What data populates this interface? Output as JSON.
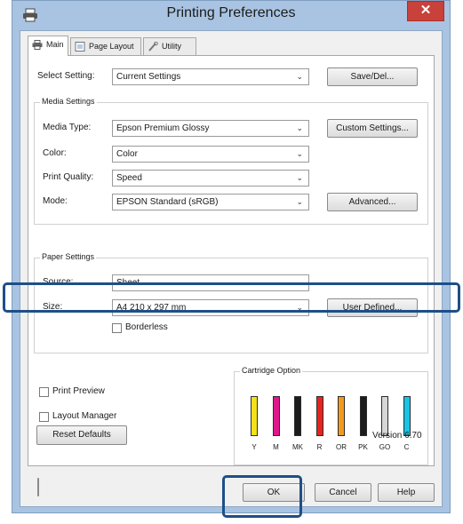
{
  "window": {
    "title": "Printing Preferences",
    "close_label": "✕"
  },
  "tabs": [
    {
      "label": "Main"
    },
    {
      "label": "Page Layout"
    },
    {
      "label": "Utility"
    }
  ],
  "select_setting": {
    "label": "Select Setting:",
    "value": "Current Settings",
    "button": "Save/Del..."
  },
  "media_settings": {
    "group_label": "Media Settings",
    "media_type": {
      "label": "Media Type:",
      "value": "Epson Premium Glossy",
      "button": "Custom Settings..."
    },
    "color": {
      "label": "Color:",
      "value": "Color"
    },
    "print_quality": {
      "label": "Print Quality:",
      "value": "Speed"
    },
    "mode": {
      "label": "Mode:",
      "value": "EPSON Standard (sRGB)",
      "button": "Advanced..."
    }
  },
  "paper_settings": {
    "group_label": "Paper Settings",
    "source": {
      "label": "Source:",
      "value": "Sheet"
    },
    "size": {
      "label": "Size:",
      "value": "A4 210 x 297 mm",
      "button": "User Defined..."
    },
    "borderless_label": "Borderless"
  },
  "print_preview_label": "Print Preview",
  "layout_manager_label": "Layout Manager",
  "cartridge": {
    "group_label": "Cartridge Option",
    "inks": [
      {
        "code": "Y",
        "color": "#f2e21a"
      },
      {
        "code": "M",
        "color": "#e0168c"
      },
      {
        "code": "MK",
        "color": "#1c1c1c"
      },
      {
        "code": "R",
        "color": "#e52420"
      },
      {
        "code": "OR",
        "color": "#f39a1c"
      },
      {
        "code": "PK",
        "color": "#1c1c1c"
      },
      {
        "code": "GO",
        "color": "#d6d6d6"
      },
      {
        "code": "C",
        "color": "#19c4e6"
      }
    ]
  },
  "reset_defaults_label": "Reset Defaults",
  "version": "Version 6.70",
  "footer": {
    "ok": "OK",
    "cancel": "Cancel",
    "help": "Help"
  },
  "colors": {
    "highlight": "#1e4f86",
    "titlebar": "#a9c4e2",
    "close": "#c8413a"
  }
}
